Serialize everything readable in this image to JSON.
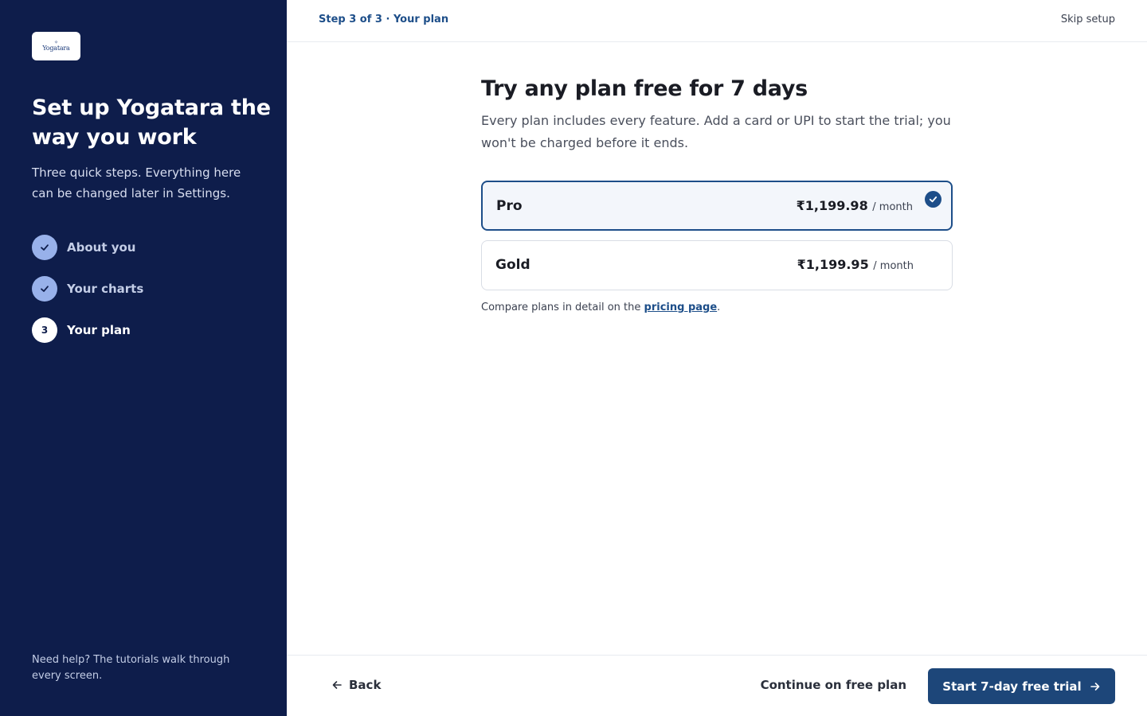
{
  "sidebar": {
    "logo_text": "Yogatara",
    "title": "Set up Yogatara the way you work",
    "subtitle": "Three quick steps. Everything here can be changed later in Settings.",
    "steps": [
      {
        "label": "About you",
        "state": "done"
      },
      {
        "label": "Your charts",
        "state": "done"
      },
      {
        "label": "Your plan",
        "state": "current",
        "number": "3"
      }
    ],
    "help_text": "Need help? The tutorials walk through every screen."
  },
  "topbar": {
    "breadcrumb": "Step 3 of 3 · Your plan",
    "skip_label": "Skip setup"
  },
  "main": {
    "title": "Try any plan free for 7 days",
    "description": "Every plan includes every feature. Add a card or UPI to start the trial; you won't be charged before it ends.",
    "plans": [
      {
        "name": "Pro",
        "price": "₹1,199.98",
        "period": "/ month",
        "selected": true
      },
      {
        "name": "Gold",
        "price": "₹1,199.95",
        "period": "/ month",
        "selected": false
      }
    ],
    "compare_prefix": "Compare plans in detail on the ",
    "compare_link": "pricing page",
    "compare_suffix": "."
  },
  "footer": {
    "back_label": "Back",
    "free_label": "Continue on free plan",
    "trial_label": "Start 7-day free trial"
  },
  "colors": {
    "sidebar_bg": "#0e1d4b",
    "accent": "#1d4e89",
    "primary_button": "#1d4679",
    "step_done": "#98b1ea"
  },
  "icons": [
    "check-icon",
    "arrow-left-icon",
    "arrow-right-icon"
  ]
}
